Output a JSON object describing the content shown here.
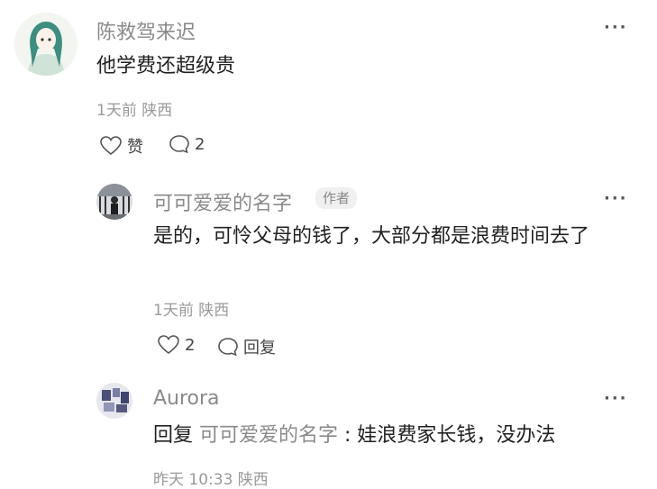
{
  "comments": [
    {
      "author": "陈救驾来迟",
      "text": "他学费还超级贵",
      "meta": "1天前 陕西",
      "like_label": "赞",
      "comment_count": "2"
    },
    {
      "author": "可可爱爱的名字",
      "badge": "作者",
      "text": "是的，可怜父母的钱了，大部分都是浪费时间去了",
      "meta": "1天前 陕西",
      "like_count": "2",
      "reply_label": "回复"
    },
    {
      "author": "Aurora",
      "reply_prefix": "回复",
      "reply_to": "可可爱爱的名字",
      "text": ": 娃浪费家长钱，没办法",
      "meta": "昨天 10:33 陕西"
    }
  ],
  "more_label": "···"
}
